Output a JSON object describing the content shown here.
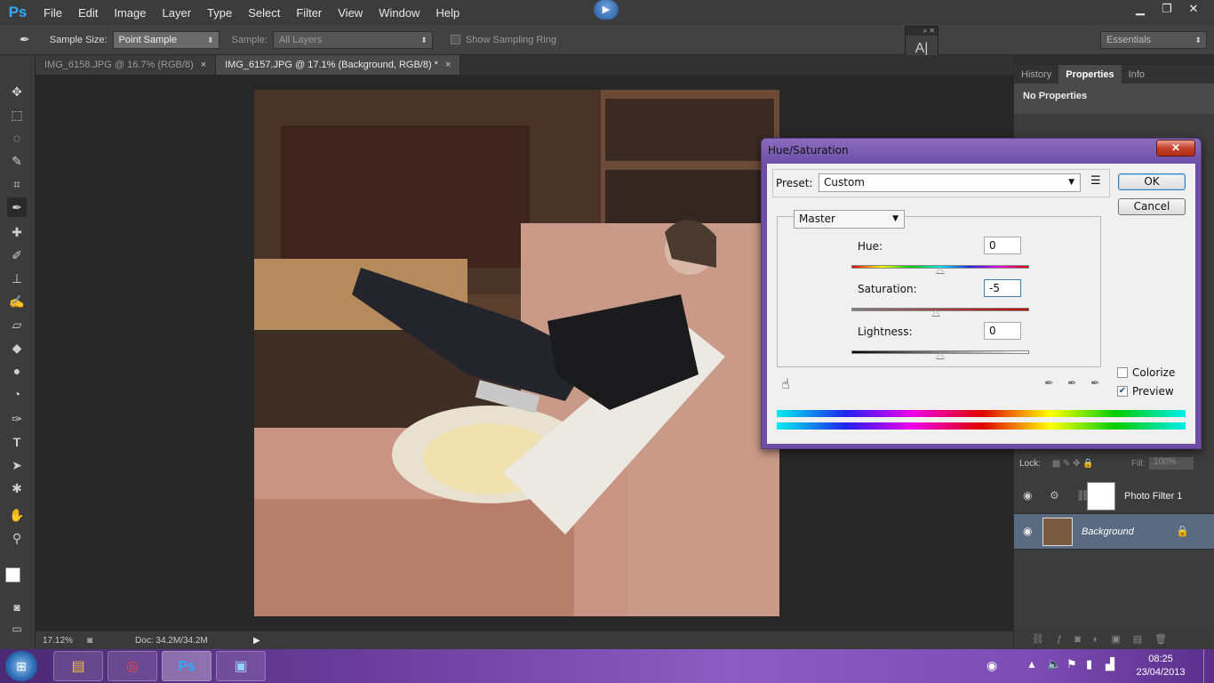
{
  "app": {
    "logo": "Ps"
  },
  "menu": [
    "File",
    "Edit",
    "Image",
    "Layer",
    "Type",
    "Select",
    "Filter",
    "View",
    "Window",
    "Help"
  ],
  "options_bar": {
    "sample_size_label": "Sample Size:",
    "sample_size_value": "Point Sample",
    "sample_label": "Sample:",
    "sample_value": "All Layers",
    "show_ring_label": "Show Sampling Ring",
    "workspace": "Essentials"
  },
  "doc_tabs": [
    {
      "label": "IMG_6158.JPG @ 16.7% (RGB/8)",
      "close": "×"
    },
    {
      "label": "IMG_6157.JPG @ 17.1% (Background, RGB/8) *",
      "close": "×"
    }
  ],
  "status": {
    "zoom": "17.12%",
    "doc": "Doc: 34.2M/34.2M"
  },
  "panels": {
    "tabs": [
      "History",
      "Properties",
      "Info"
    ],
    "properties_text": "No Properties",
    "lock_label": "Lock:",
    "fill_label": "Fill:",
    "fill_value": "100%",
    "layers": [
      {
        "name": "Photo Filter 1"
      },
      {
        "name": "Background"
      }
    ]
  },
  "dialog": {
    "title": "Hue/Saturation",
    "close": "✕",
    "preset_label": "Preset:",
    "preset_value": "Custom",
    "ok": "OK",
    "cancel": "Cancel",
    "channel": "Master",
    "hue_label": "Hue:",
    "hue_value": "0",
    "sat_label": "Saturation:",
    "sat_value": "-5",
    "light_label": "Lightness:",
    "light_value": "0",
    "colorize_label": "Colorize",
    "preview_label": "Preview",
    "colorize_checked": false,
    "preview_checked": true,
    "hue_pos": 0.5,
    "sat_pos": 0.475,
    "light_pos": 0.5
  },
  "taskbar": {
    "time": "08:25",
    "date": "23/04/2013"
  },
  "icons": {
    "eyedropper": "eyedropper-icon",
    "eye": "eye-icon",
    "lock": "lock-icon"
  }
}
